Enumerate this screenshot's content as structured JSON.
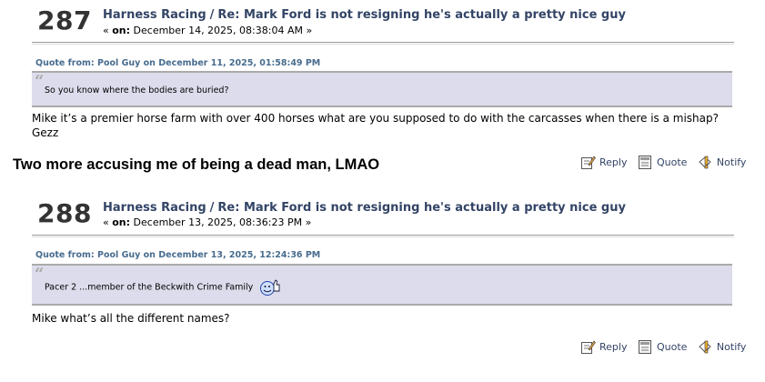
{
  "posts": [
    {
      "number": "287",
      "board": "Harness Racing",
      "separator": "/",
      "topic": "Re: Mark Ford is not resigning he's actually a pretty nice guy",
      "date_prefix": "« ",
      "date_on": "on:",
      "date_value": " December 14, 2025, 08:38:04 AM »",
      "quote_header": "Quote from: Pool Guy on December 11, 2025, 01:58:49 PM",
      "quote_text": "So you know where the bodies are buried?",
      "body": "Mike it’s a premier horse farm with over 400 horses what are you supposed to do with the carcasses when there is a mishap? Gezz",
      "actions": {
        "reply": "Reply",
        "quote": "Quote",
        "notify": "Notify"
      }
    },
    {
      "number": "288",
      "board": "Harness Racing",
      "separator": "/",
      "topic": "Re: Mark Ford is not resigning he's actually a pretty nice guy",
      "date_prefix": "« ",
      "date_on": "on:",
      "date_value": " December 13, 2025, 08:36:23 PM »",
      "quote_header": "Quote from: Pool Guy on December 13, 2025, 12:24:36 PM",
      "quote_text": "Pacer 2 ...member of the Beckwith Crime Family",
      "quote_icon": "thumbs-up-smiley-icon",
      "body": "Mike what’s all the different names?",
      "actions": {
        "reply": "Reply",
        "quote": "Quote",
        "notify": "Notify"
      }
    }
  ],
  "signature": "Two more accusing me of being a dead man, LMAO",
  "colors": {
    "title": "#334466",
    "quote_header": "#476c8e",
    "quote_bg": "#dcdcec"
  }
}
